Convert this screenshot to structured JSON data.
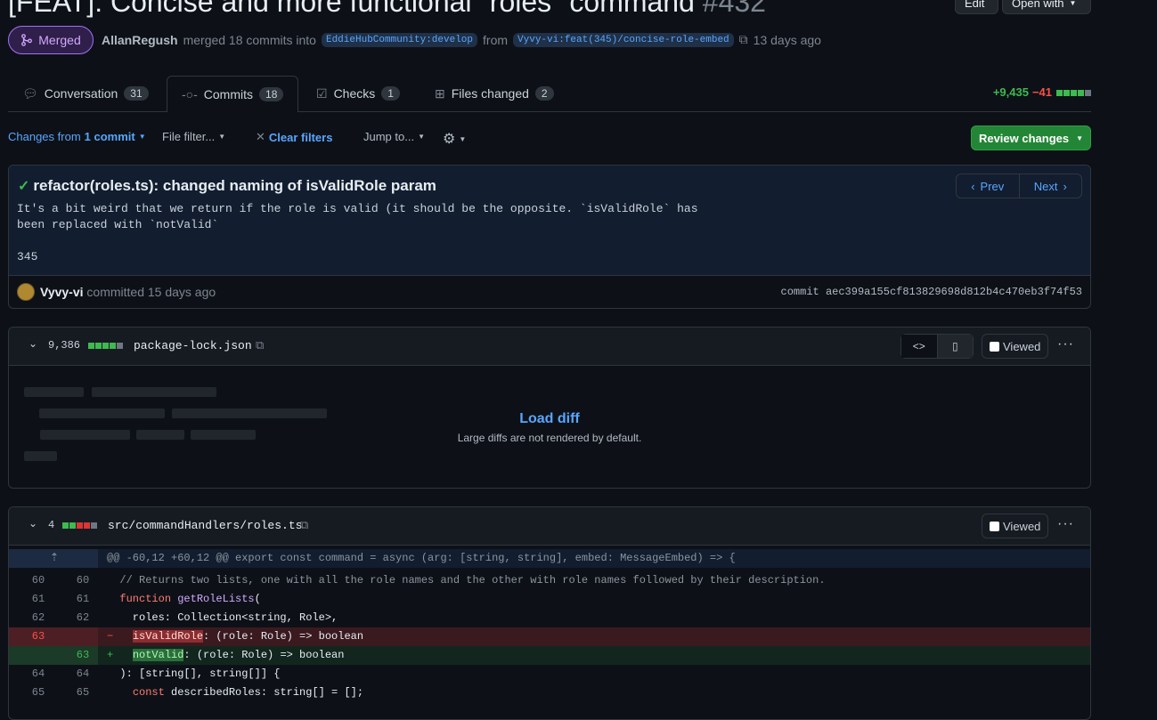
{
  "header": {
    "title": "[FEAT]: Concise and more functional \"roles\" command",
    "number": "#432",
    "edit_label": "Edit",
    "open_with_label": "Open with",
    "status": "Merged",
    "merger": "AllanRegush",
    "merged_text": "merged 18 commits into",
    "base_branch": "EddieHubCommunity:develop",
    "from_text": "from",
    "head_branch": "Vyvy-vi:feat(345)/concise-role-embed",
    "time": "13 days ago"
  },
  "tabs": [
    {
      "label": "Conversation",
      "count": "31",
      "icon": "comment-discussion-icon"
    },
    {
      "label": "Commits",
      "count": "18",
      "icon": "git-commit-icon",
      "active": true
    },
    {
      "label": "Checks",
      "count": "1",
      "icon": "checklist-icon"
    },
    {
      "label": "Files changed",
      "count": "2",
      "icon": "file-diff-icon"
    }
  ],
  "diffstat": {
    "additions": "+9,435",
    "deletions": "−41"
  },
  "toolbar": {
    "changes_from": "Changes from",
    "commit_count": "1 commit",
    "file_filter": "File filter...",
    "clear_filters": "Clear filters",
    "jump_to": "Jump to...",
    "review_changes": "Review changes"
  },
  "commit": {
    "title": "refactor(roles.ts): changed naming of isValidRole param",
    "body_line1": "It's a bit weird that we return if the role is valid (it should be the opposite. `isValidRole` has",
    "body_line2": "been replaced with `notValid`",
    "body_line3": "345",
    "prev": "Prev",
    "next": "Next",
    "author": "Vyvy-vi",
    "committed_text": "committed 15 days ago",
    "sha": "commit aec399a155cf813829698d812b4c470eb3f74f53"
  },
  "files": [
    {
      "changes": "9,386",
      "name": "package-lock.json",
      "viewed_label": "Viewed",
      "load_diff": "Load diff",
      "load_sub": "Large diffs are not rendered by default."
    },
    {
      "changes": "4",
      "name": "src/commandHandlers/roles.ts",
      "viewed_label": "Viewed",
      "hunk": "@@ -60,12 +60,12 @@ export const command = async (arg: [string, string], embed: MessageEmbed) => {",
      "lines": [
        {
          "old": "60",
          "new": "60",
          "type": "ctx",
          "text": "  // Returns two lists, one with all the role names and the other with role names followed by their description."
        },
        {
          "old": "61",
          "new": "61",
          "type": "ctx",
          "text": "  function getRoleLists("
        },
        {
          "old": "62",
          "new": "62",
          "type": "ctx",
          "text": "    roles: Collection<string, Role>,"
        },
        {
          "old": "63",
          "new": "",
          "type": "del",
          "text": "isValidRole: (role: Role) => boolean"
        },
        {
          "old": "",
          "new": "63",
          "type": "add",
          "text": "notValid: (role: Role) => boolean"
        },
        {
          "old": "64",
          "new": "64",
          "type": "ctx",
          "text": "  ): [string[], string[]] {"
        },
        {
          "old": "65",
          "new": "65",
          "type": "ctx",
          "text": "    const describedRoles: string[] = [];"
        }
      ]
    }
  ]
}
